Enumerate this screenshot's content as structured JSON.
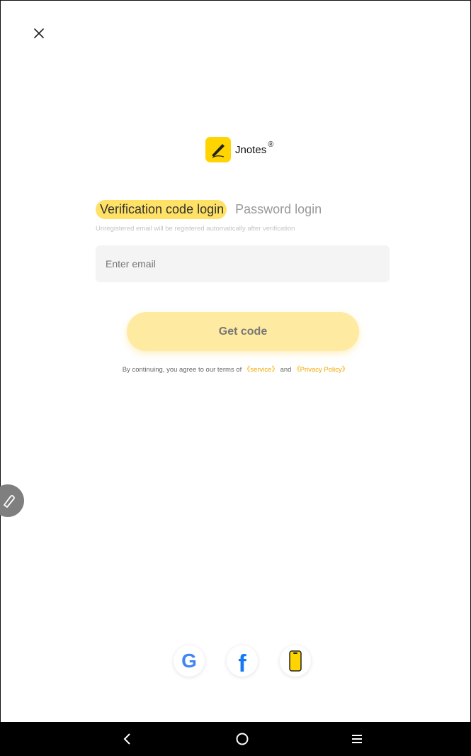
{
  "brand": {
    "name": "Jnotes",
    "mark": "®"
  },
  "tabs": {
    "active": "Verification code login",
    "inactive": "Password login"
  },
  "hint": "Unregistered email will be registered automatically after verification",
  "email": {
    "placeholder": "Enter email",
    "value": ""
  },
  "get_code_label": "Get code",
  "terms": {
    "prefix": "By continuing, you agree to our terms of ",
    "service": "《service》",
    "middle": " and ",
    "privacy": "《Privacy Policy》"
  },
  "social": {
    "google_glyph": "G",
    "facebook_glyph": "f"
  },
  "colors": {
    "accent": "#FFD400",
    "tab_highlight": "#FFE165",
    "button": "#FFEAA1",
    "link": "#F5A800"
  },
  "icons": {
    "close": "close-icon",
    "logo": "pen-logo-icon",
    "edit": "pen-icon",
    "phone": "phone-icon",
    "back": "chevron-left-icon",
    "home": "circle-home-icon",
    "menu": "hamburger-menu-icon"
  }
}
